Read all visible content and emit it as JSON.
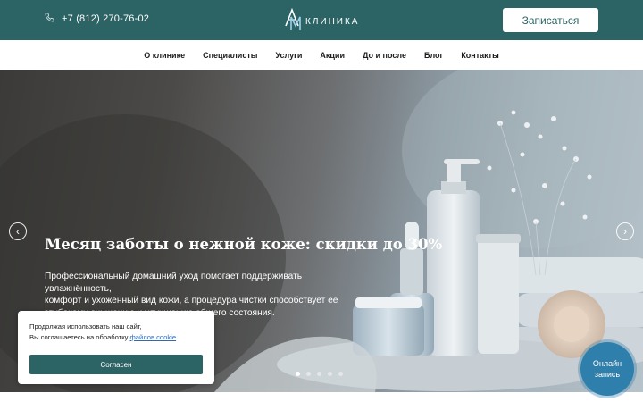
{
  "header": {
    "phone": "+7 (812) 270-76-02",
    "logo_letters": "AM",
    "logo_text": "КЛИНИКА",
    "signup_label": "Записаться"
  },
  "nav": {
    "items": [
      {
        "label": "О клинике"
      },
      {
        "label": "Специалисты"
      },
      {
        "label": "Услуги"
      },
      {
        "label": "Акции"
      },
      {
        "label": "До и после"
      },
      {
        "label": "Блог"
      },
      {
        "label": "Контакты"
      }
    ]
  },
  "hero": {
    "title": "Месяц заботы о нежной коже: скидки до 30%",
    "text_lines": [
      "Профессиональный домашний уход помогает поддерживать увлажнённость,",
      "комфорт и ухоженный вид кожи, а процедура чистки способствует её",
      "глубокому очищению и улучшению общего состояния."
    ],
    "prev_icon": "chevron-left-icon",
    "next_icon": "chevron-right-icon",
    "slides_total": 5,
    "active_slide": 1
  },
  "cookie": {
    "line1": "Продолжая использовать наш сайт,",
    "line2_prefix": "Вы соглашаетесь на обработку ",
    "link_text": "файлов cookie",
    "accept_label": "Согласен"
  },
  "online_booking": {
    "line1": "Онлайн",
    "line2": "запись"
  },
  "colors": {
    "brand": "#2c6466",
    "online_button": "#2e7fab",
    "link": "#2d6bb5"
  }
}
